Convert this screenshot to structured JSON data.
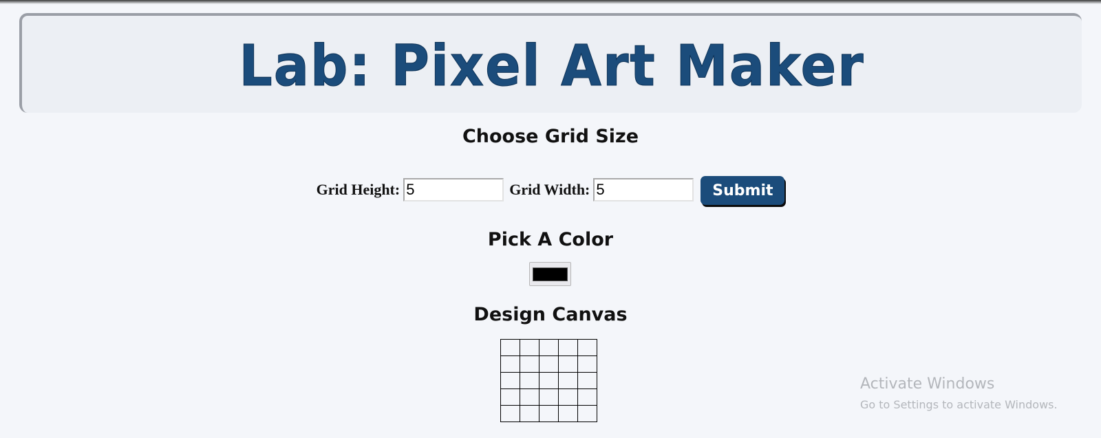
{
  "header": {
    "title": "Lab: Pixel Art Maker"
  },
  "grid_size": {
    "heading": "Choose Grid Size",
    "height_label": "Grid Height:",
    "height_value": "5",
    "width_label": "Grid Width:",
    "width_value": "5",
    "submit_label": "Submit"
  },
  "color": {
    "heading": "Pick A Color",
    "value": "#000000"
  },
  "canvas": {
    "heading": "Design Canvas",
    "rows": 5,
    "cols": 5
  },
  "watermark": {
    "line1": "Activate Windows",
    "line2": "Go to Settings to activate Windows."
  },
  "colors": {
    "accent": "#1b4c7b",
    "background": "#f4f6fa"
  }
}
